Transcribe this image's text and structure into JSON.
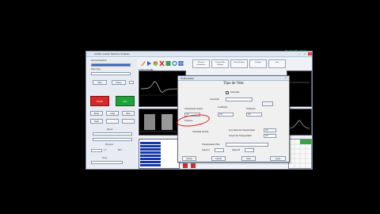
{
  "app": {
    "title": "SofTac Leather Machine Software",
    "top_status": "IP: 192.168.1.20  OK"
  },
  "left_panel": {
    "section_label": "Selected Machine",
    "field_label": "Plate Type",
    "buttons": [
      "Start",
      "Pause",
      "Reset",
      "Load",
      "Save",
      "Clear"
    ],
    "stop_label": "STOP",
    "go_label": "GO",
    "bottom_labels": [
      "Speed",
      "Pressure",
      "Temp"
    ],
    "values": [
      "1.7",
      "88.0"
    ]
  },
  "toolbar": {
    "buttons": [
      "Machine Parameters",
      "Cutting Table Settings",
      "Head Settings",
      "Settings",
      "Print"
    ]
  },
  "graph": {
    "header": "Cutting Profile"
  },
  "dialog": {
    "title": "Profile Editor",
    "heading": "Tipo de Vent",
    "radio_label": "Automatic",
    "field1_label": "Contenido",
    "group_labels": [
      "Consumption Factor",
      "Coefficient",
      "Thickness"
    ],
    "values": [
      "0.0",
      "0.0",
      "0.0"
    ],
    "circled_label": "Pressure",
    "sub_label": "Velocidad del Filo",
    "row_labels": [
      "Temp Max del Transportador",
      "Grosor del Transportador"
    ],
    "row_values": [
      "0.0",
      "0.0"
    ],
    "lower_label": "Transportation Pilot",
    "opt_labels": [
      "Option A",
      "Option B"
    ],
    "buttons": [
      "Accept",
      "Cancel",
      "Save",
      "Apply"
    ]
  },
  "colors": {
    "annotation": "#e01818",
    "stop": "#d42a2a",
    "go": "#1fa23a",
    "table_row": "#1838a8"
  }
}
